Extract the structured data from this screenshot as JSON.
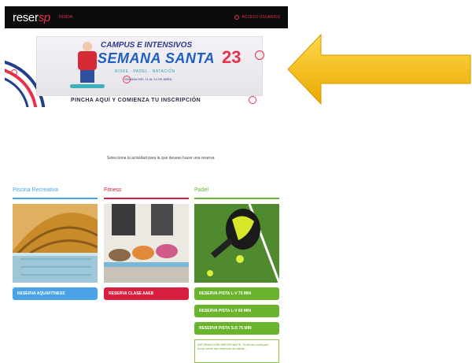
{
  "header": {
    "logo_main": "reser",
    "logo_accent": "sp",
    "nav_link": "TIENDA",
    "login_label": "ACCESO USUARIOS"
  },
  "banner": {
    "headline": "CAMPUS E INTENSIVOS",
    "title": "SEMANA SANTA",
    "year": "23",
    "sports": "RISKE · PADEL · NATACIÓN",
    "dates": "SEMANA DEL 11 AL 14 DE ABRIL",
    "cta": "PINCHA AQUÍ Y COMIENZA TU INSCRIPCIÓN"
  },
  "select_text": "Selecciona la actividad para la que deseas hacer una reserva",
  "columns": [
    {
      "title": "Piscina Recreativa",
      "color": "#4aa3e8",
      "buttons": [
        "RESERVA AQUAFITNESS"
      ]
    },
    {
      "title": "Fitness",
      "color": "#d81f3f",
      "buttons": [
        "RESERVA CLASE AAEB"
      ]
    },
    {
      "title": "Padel",
      "color": "#6ab42d",
      "buttons": [
        "RESERVA PISTA L-V 75 MIN",
        "RESERVA PISTA L-V 60 MIN",
        "RESERVA PISTA S-D 75 MIN"
      ],
      "info": "INFORMACIÓN IMPORTANTE: Si tienes cualquier duda sobre las reservas de pistas..."
    }
  ],
  "colors": {
    "topbar": "#0b0b0b",
    "accent": "#e5334b",
    "arrow": "#f5b800"
  }
}
